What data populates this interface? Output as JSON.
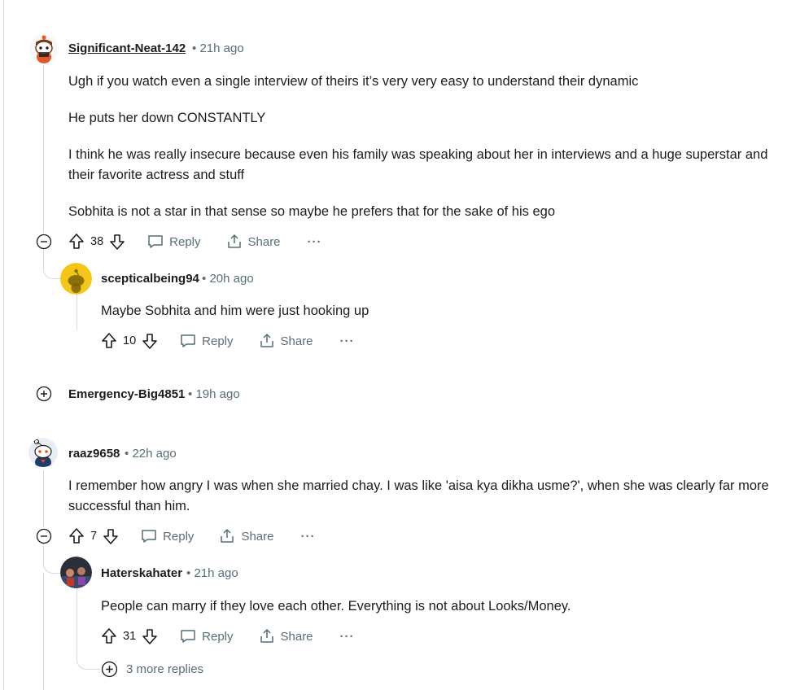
{
  "comments": [
    {
      "author": "Significant-Neat-142",
      "time": "21h ago",
      "paragraphs": [
        "Ugh if you watch even a single interview of theirs it’s very very easy to understand their dynamic",
        "He puts her down CONSTANTLY",
        "I think he was really insecure because even his family was speaking about her in interviews and a huge superstar and their favorite actress and stuff",
        "Sobhita is not a star in that sense so maybe he prefers that for the sake of his ego"
      ],
      "votes": "38",
      "reply_label": "Reply",
      "share_label": "Share",
      "more_label": "···"
    },
    {
      "author": "scepticalbeing94",
      "time": "20h ago",
      "paragraphs": [
        "Maybe Sobhita and him were just hooking up"
      ],
      "votes": "10",
      "reply_label": "Reply",
      "share_label": "Share",
      "more_label": "···"
    },
    {
      "author": "Emergency-Big4851",
      "time": "19h ago"
    },
    {
      "author": "raaz9658",
      "time": "22h ago",
      "paragraphs": [
        "I remember how angry I was when she married chay. I was like 'aisa kya dikha usme?', when she was clearly far more successful than him."
      ],
      "votes": "7",
      "reply_label": "Reply",
      "share_label": "Share",
      "more_label": "···"
    },
    {
      "author": "Haterskahater",
      "time": "21h ago",
      "paragraphs": [
        "People can marry if they love each other. Everything is not about Looks/Money."
      ],
      "votes": "31",
      "reply_label": "Reply",
      "share_label": "Share",
      "more_label": "···"
    }
  ],
  "more_replies": "3 more replies",
  "separator": "•"
}
